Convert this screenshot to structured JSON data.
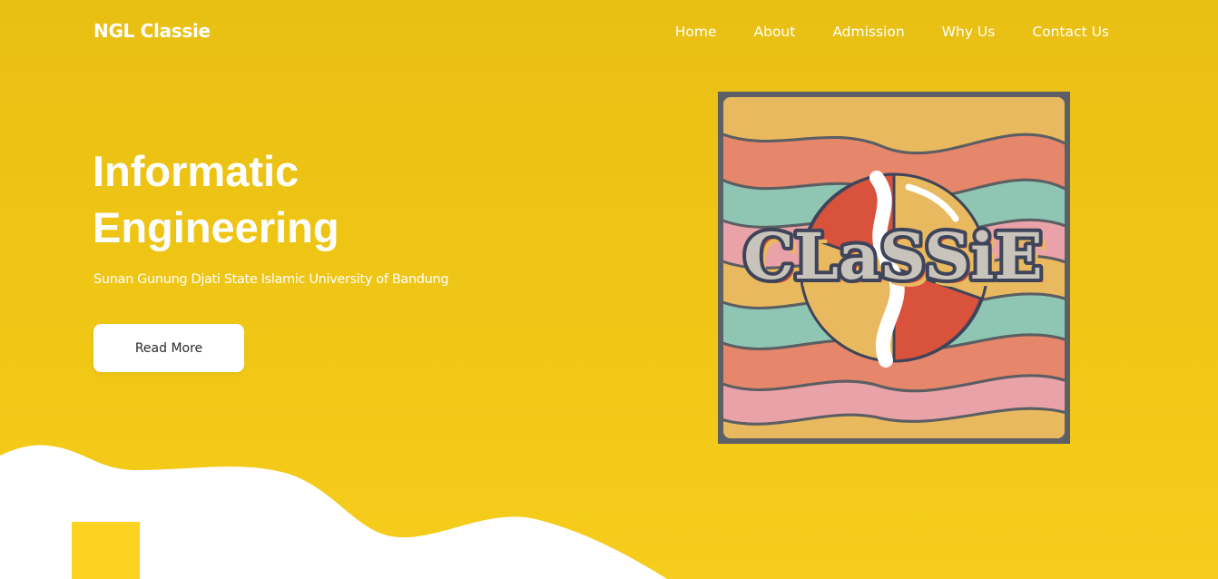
{
  "header": {
    "brand": "NGL Classie",
    "nav": [
      "Home",
      "About",
      "Admission",
      "Why Us",
      "Contact Us"
    ]
  },
  "hero": {
    "title_line1": "Informatic",
    "title_line2": "Engineering",
    "subtitle": "Sunan Gunung Djati State Islamic University of Bandung",
    "button_label": "Read More"
  },
  "logo": {
    "text": "CLaSSiE",
    "icon": "classie-retro-logo"
  },
  "colors": {
    "background": "#edc315",
    "text": "#ffffff",
    "button_bg": "#ffffff",
    "button_text": "#2a2a2a",
    "accent_square": "#fbd320"
  }
}
